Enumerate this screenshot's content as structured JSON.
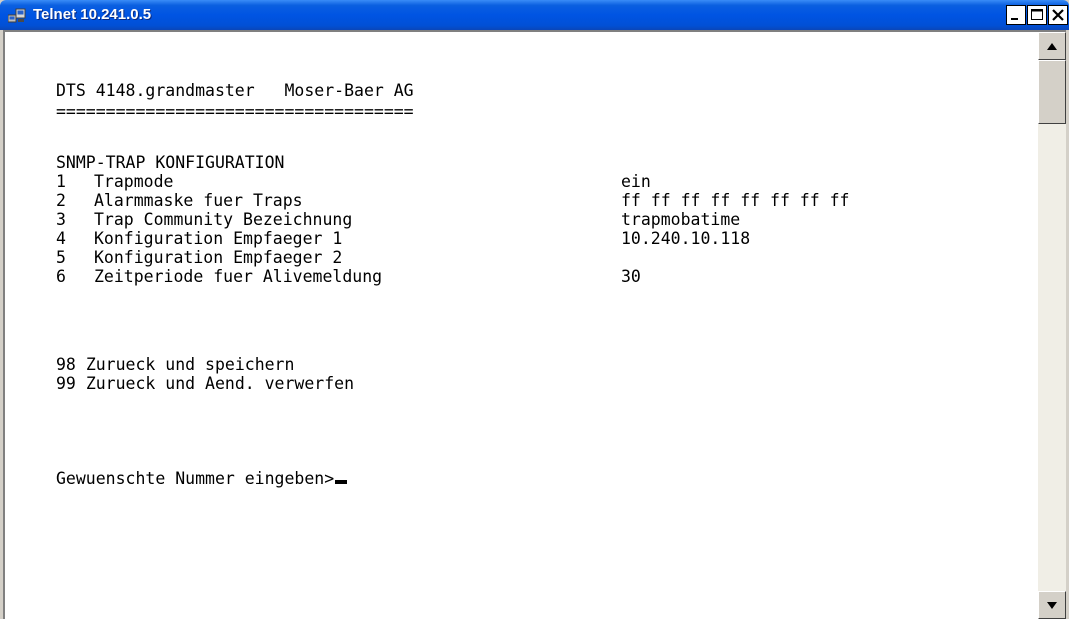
{
  "window": {
    "title": "Telnet 10.241.0.5",
    "icon": "telnet-terminal-icon",
    "controls": [
      "minimize-icon",
      "maximize-icon",
      "close-icon"
    ]
  },
  "terminal": {
    "header": "DTS 4148.grandmaster   Moser-Baer AG",
    "separator": "====================================",
    "section_title": "SNMP-TRAP KONFIGURATION",
    "menu": [
      {
        "num": "1",
        "label": "Trapmode",
        "value": "ein"
      },
      {
        "num": "2",
        "label": "Alarmmaske fuer Traps",
        "value": "ff ff ff ff ff ff ff ff"
      },
      {
        "num": "3",
        "label": "Trap Community Bezeichnung",
        "value": "trapmobatime"
      },
      {
        "num": "4",
        "label": "Konfiguration Empfaeger 1",
        "value": "10.240.10.118"
      },
      {
        "num": "5",
        "label": "Konfiguration Empfaeger 2",
        "value": ""
      },
      {
        "num": "6",
        "label": "Zeitperiode fuer Alivemeldung",
        "value": "30"
      }
    ],
    "actions": [
      {
        "num": "98",
        "label": "Zurueck und speichern"
      },
      {
        "num": "99",
        "label": "Zurueck und Aend. verwerfen"
      }
    ],
    "prompt": "Gewuenschte Nummer eingeben>"
  },
  "colors": {
    "titlebar": "#0054e3",
    "close_button": "#ffffff",
    "terminal_bg": "#ffffff",
    "terminal_text": "#000000"
  }
}
